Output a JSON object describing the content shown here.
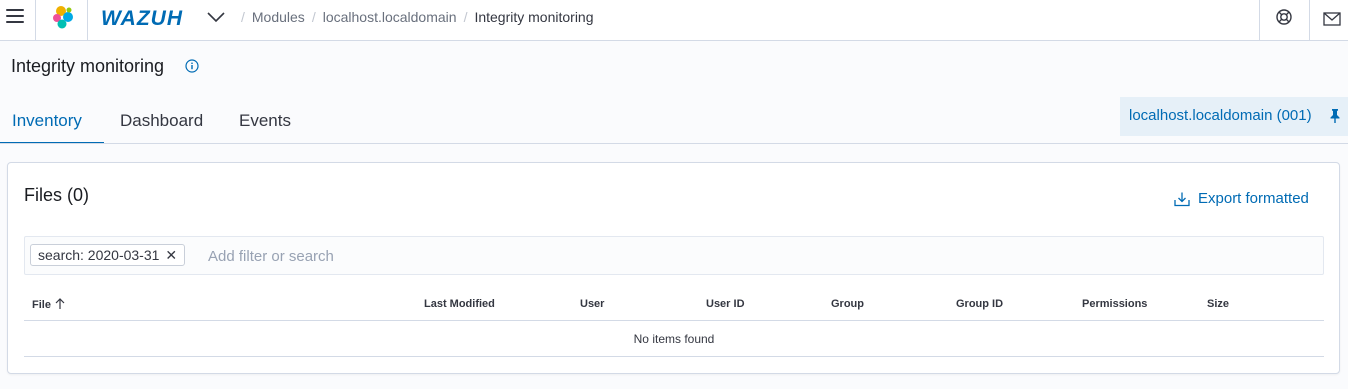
{
  "header": {
    "logo_text": "WAZUH",
    "breadcrumbs": [
      "Modules",
      "localhost.localdomain"
    ],
    "current": "Integrity monitoring"
  },
  "page": {
    "title": "Integrity monitoring"
  },
  "tabs": [
    {
      "label": "Inventory",
      "active": true
    },
    {
      "label": "Dashboard",
      "active": false
    },
    {
      "label": "Events",
      "active": false
    }
  ],
  "agent": {
    "label": "localhost.localdomain (001)"
  },
  "panel": {
    "title": "Files (0)",
    "export_label": "Export formatted",
    "filter_pill": "search: 2020-03-31",
    "search_placeholder": "Add filter or search"
  },
  "table": {
    "columns": [
      "File",
      "Last Modified",
      "User",
      "User ID",
      "Group",
      "Group ID",
      "Permissions",
      "Size"
    ],
    "empty_message": "No items found"
  },
  "colors": {
    "accent": "#006bb4",
    "border": "#d3dae6"
  }
}
